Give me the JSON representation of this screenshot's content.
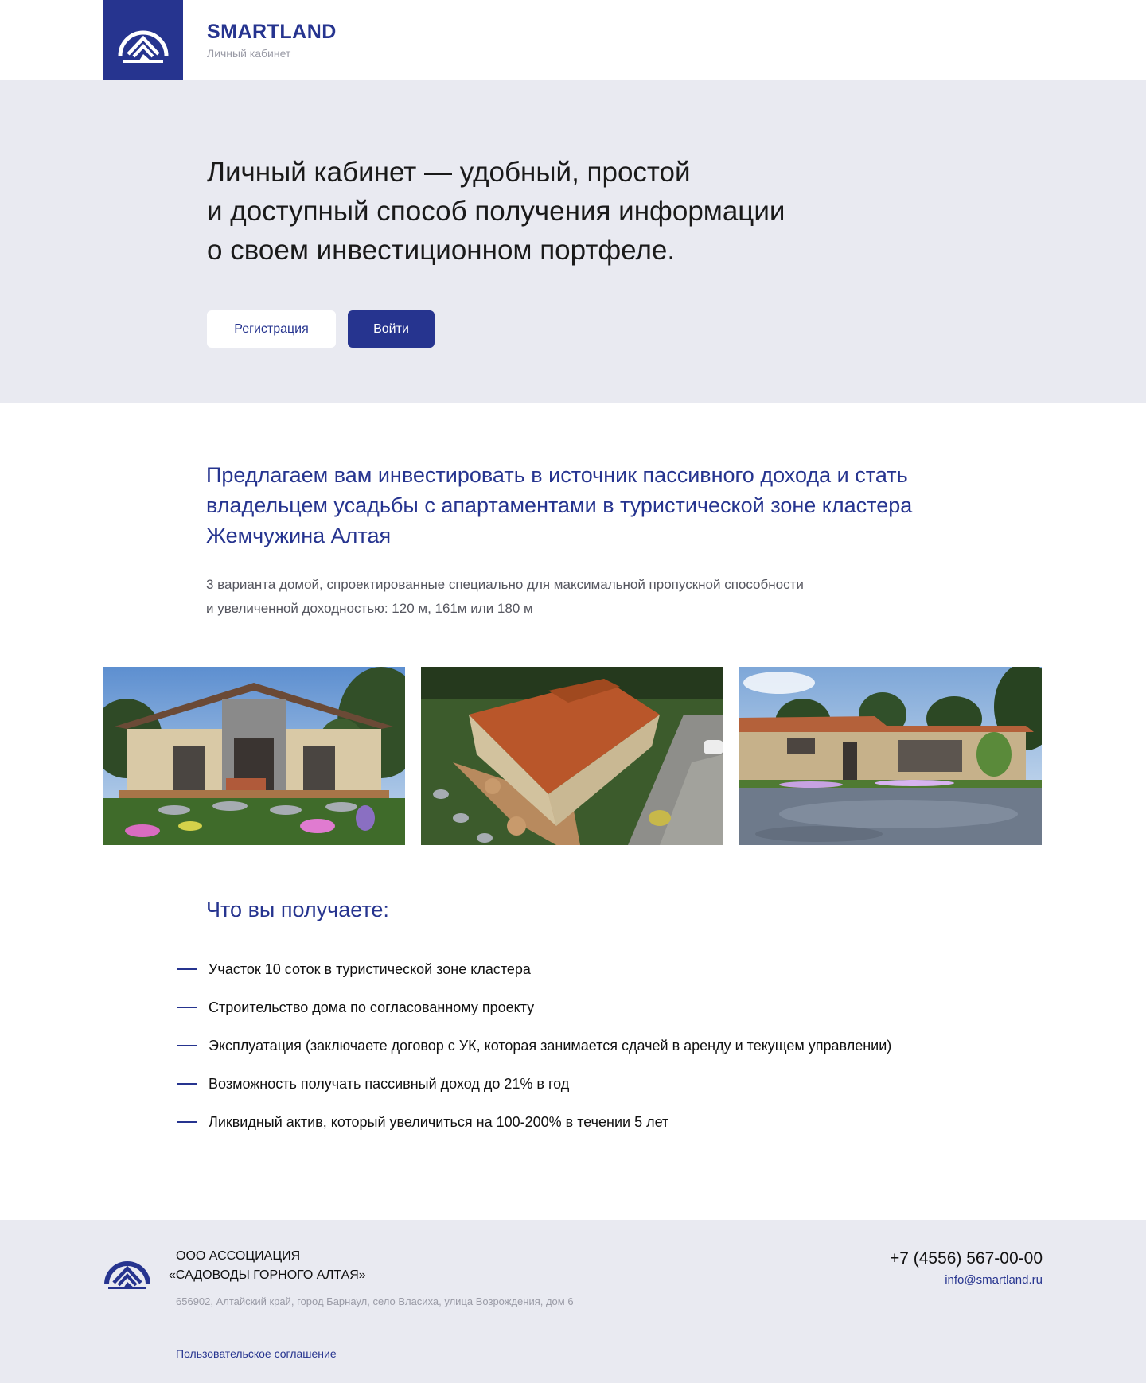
{
  "colors": {
    "brand": "#26348f",
    "light_bg": "#e9eaf1",
    "muted_text": "#9a9ba6"
  },
  "header": {
    "logo_icon": "house-arch-logo",
    "brand_name": "SMARTLAND",
    "subtitle": "Личный кабинет"
  },
  "hero": {
    "title": "Личный кабинет — удобный, простой\nи доступный способ получения информации\nо своем инвестиционном портфеле.",
    "register_label": "Регистрация",
    "login_label": "Войти"
  },
  "offer": {
    "title": "Предлагаем вам инвестировать в источник пассивного дохода и стать владельцем усадьбы с апартаментами в туристической зоне кластера Жемчужина Алтая",
    "description": "3 варианта домой, спроектированные специально для максимальной пропускной способности и увеличенной доходностью: 120 м, 161м или 180 м"
  },
  "benefits": {
    "title": "Что вы получаете:",
    "items": [
      "Участок 10 соток в туристической зоне кластера",
      "Строительство дома по согласованному проекту",
      "Эксплуатация  (заключаете договор с УК, которая занимается сдачей в аренду и текущем управлении)",
      "Возможность получать пассивный доход до 21% в год",
      "Ликвидный актив, который увеличиться на 100-200% в течении 5 лет"
    ]
  },
  "footer": {
    "org_name_line1": "ООО АССОЦИАЦИЯ",
    "org_name_line2": "«САДОВОДЫ ГОРНОГО АЛТАЯ»",
    "address": "656902, Алтайский край, город Барнаул, село Власиха, улица Возрождения, дом 6",
    "agreement_link": "Пользовательское соглашение",
    "phone": "+7 (4556) 567-00-00",
    "email": "info@smartland.ru"
  }
}
